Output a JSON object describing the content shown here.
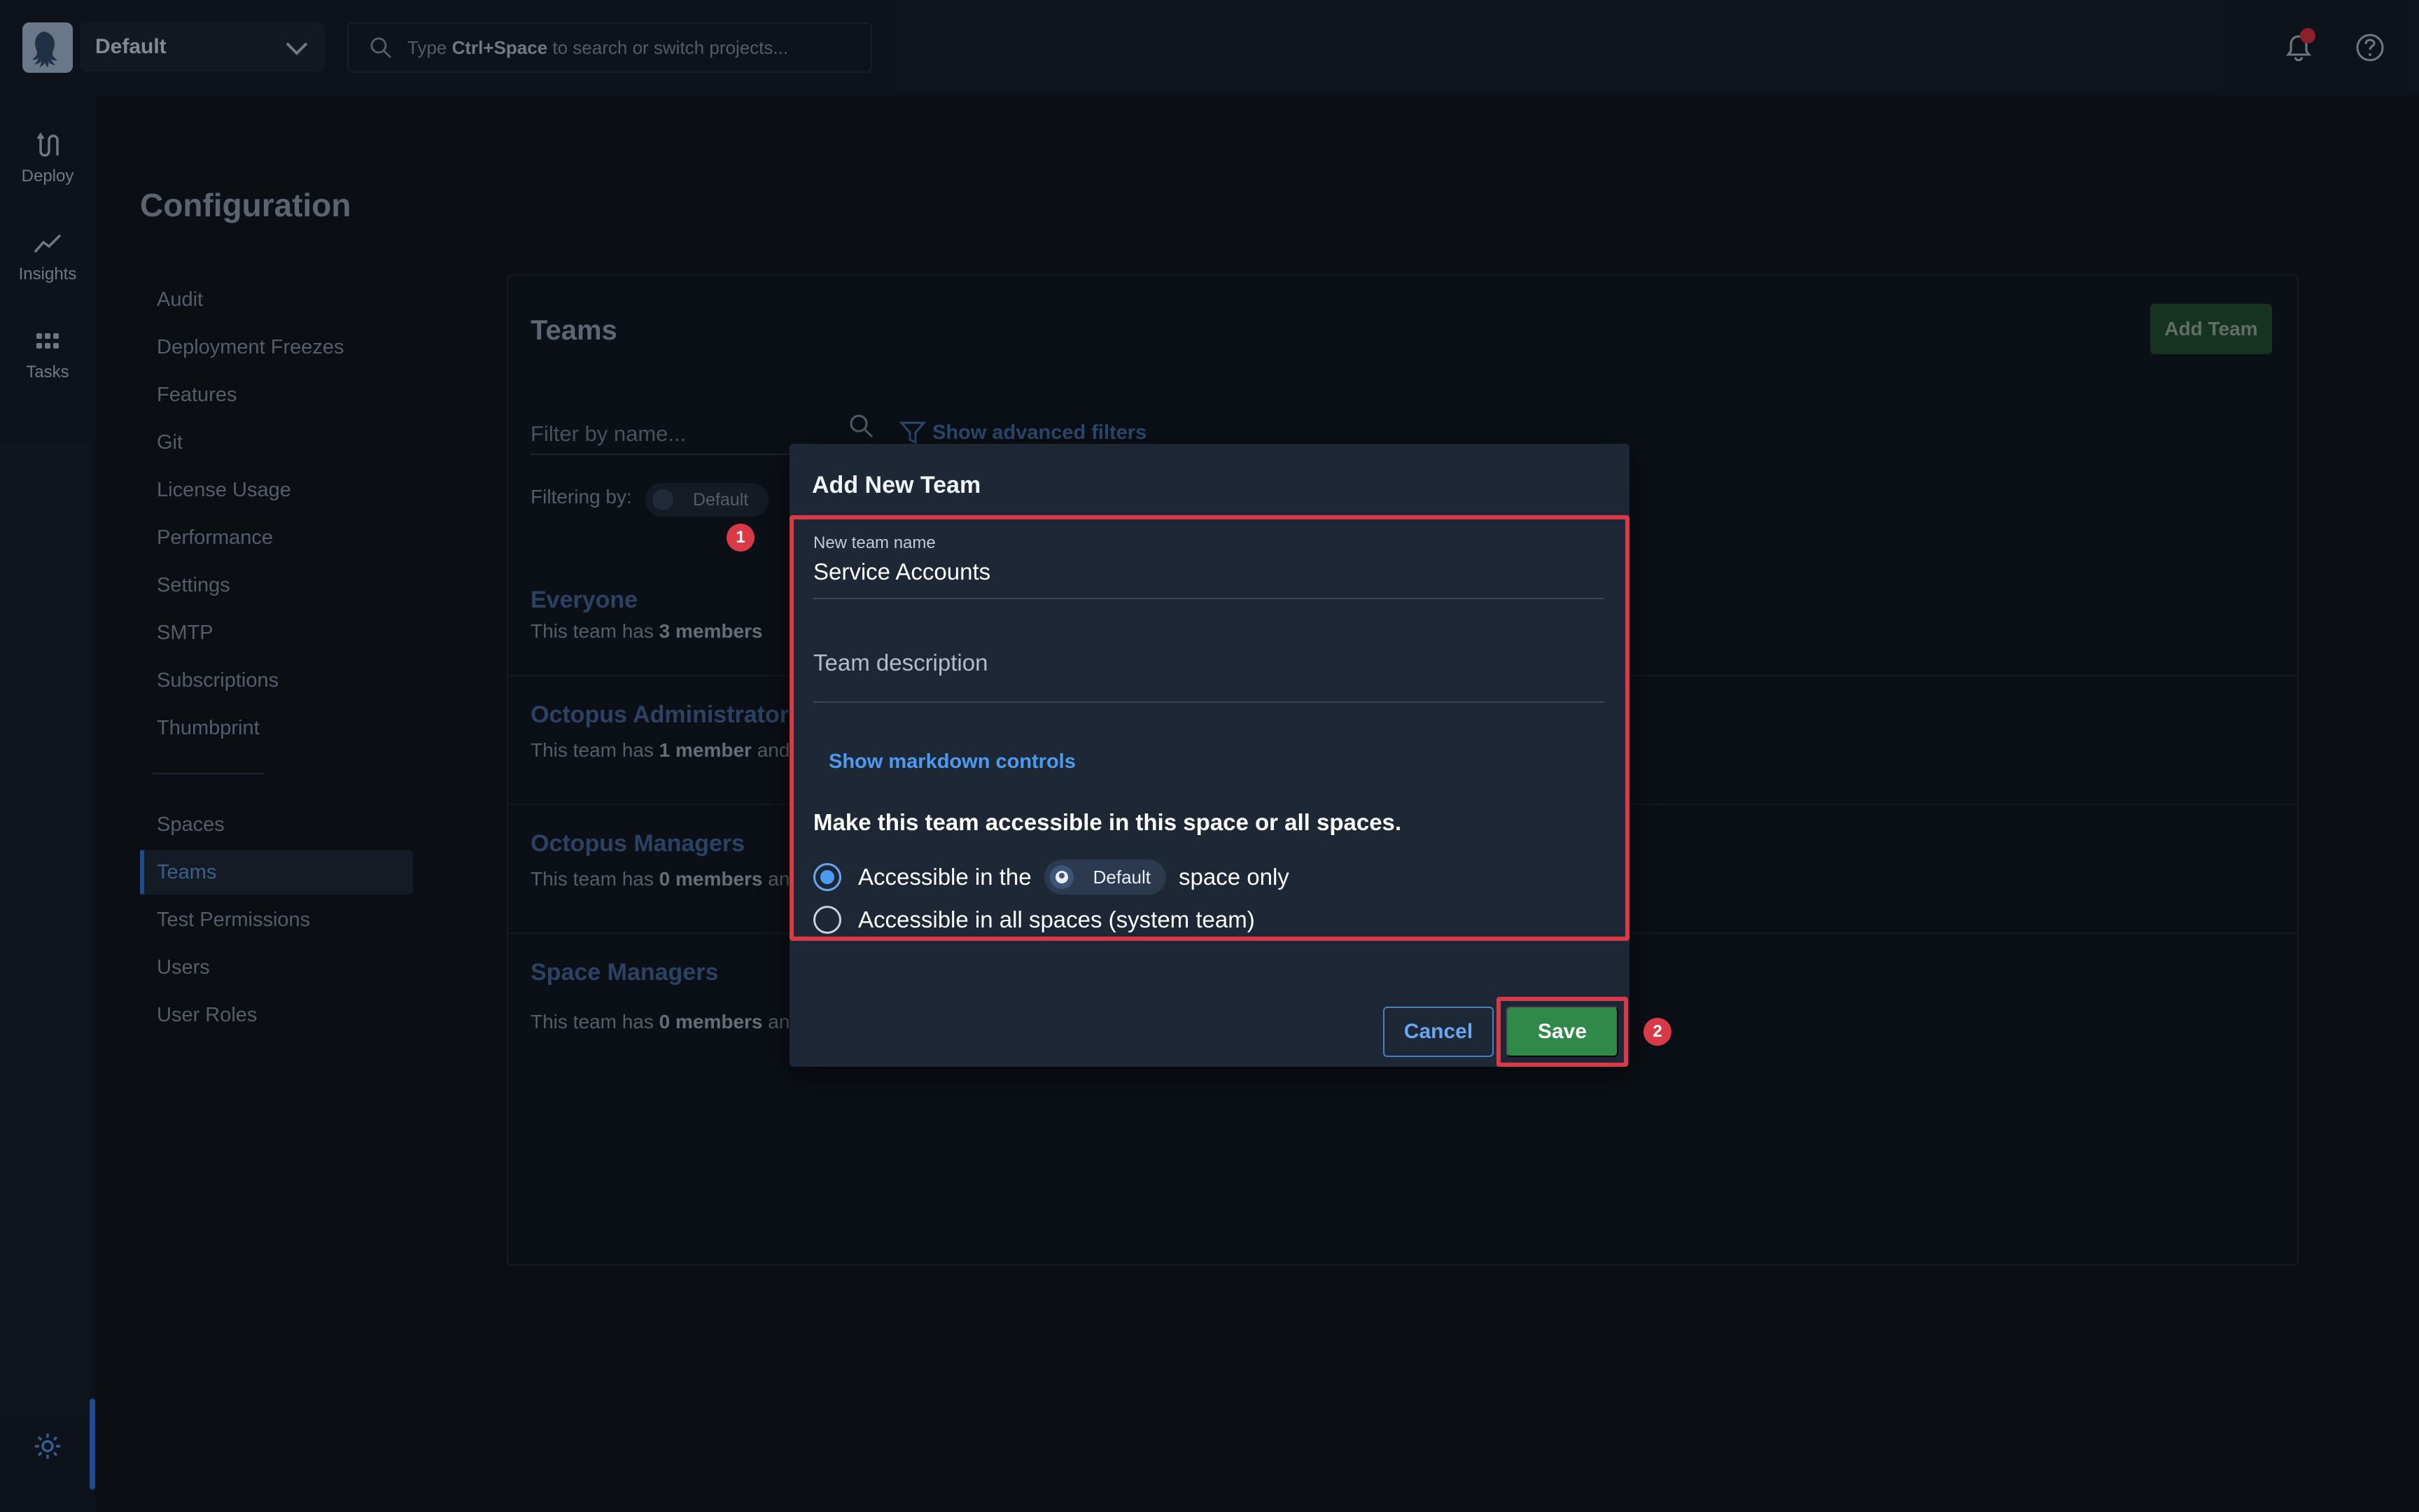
{
  "header": {
    "space_name": "Default",
    "search_placeholder_pre": "Type ",
    "search_placeholder_key": "Ctrl+Space",
    "search_placeholder_post": " to search or switch projects..."
  },
  "rail": {
    "items": [
      {
        "label": "Deploy",
        "icon": "deploy-icon"
      },
      {
        "label": "Insights",
        "icon": "insights-icon"
      },
      {
        "label": "Tasks",
        "icon": "tasks-icon"
      }
    ]
  },
  "page": {
    "title": "Configuration",
    "nav_primary": [
      "Audit",
      "Deployment Freezes",
      "Features",
      "Git",
      "License Usage",
      "Performance",
      "Settings",
      "SMTP",
      "Subscriptions",
      "Thumbprint"
    ],
    "nav_secondary": [
      "Spaces",
      "Teams",
      "Test Permissions",
      "Users",
      "User Roles"
    ],
    "active_nav": "Teams"
  },
  "teams": {
    "title": "Teams",
    "add_button": "Add Team",
    "filter_placeholder": "Filter by name...",
    "advanced_filters": "Show advanced filters",
    "filtering_by": "Filtering by:",
    "filter_chip": "Default",
    "rows": [
      {
        "name": "Everyone",
        "sub_pre": "This team has ",
        "sub_bold": "3 members"
      },
      {
        "name": "Octopus Administrators",
        "sub_pre": "This team has ",
        "sub_bold": "1 member",
        "sub_post": " and"
      },
      {
        "name": "Octopus Managers",
        "sub_pre": "This team has ",
        "sub_bold": "0 members",
        "sub_post": " and"
      },
      {
        "name": "Space Managers",
        "sub_pre": "This team has ",
        "sub_bold": "0 members",
        "sub_post": " and"
      }
    ]
  },
  "dialog": {
    "title": "Add New Team",
    "name_label": "New team name",
    "name_value": "Service Accounts",
    "description_placeholder": "Team description",
    "markdown_link": "Show markdown controls",
    "access_heading": "Make this team accessible in this space or all spaces.",
    "option_space_pre": "Accessible in the",
    "option_space_chip": "Default",
    "option_space_post": "space only",
    "option_all": "Accessible in all spaces (system team)",
    "selected_option": "space",
    "cancel": "Cancel",
    "save": "Save"
  },
  "annotations": {
    "step1": "1",
    "step2": "2"
  },
  "colors": {
    "accent": "#4d9bf0",
    "save": "#2f8a4a",
    "highlight": "#d93a48",
    "add_team": "#1f4a2d"
  }
}
